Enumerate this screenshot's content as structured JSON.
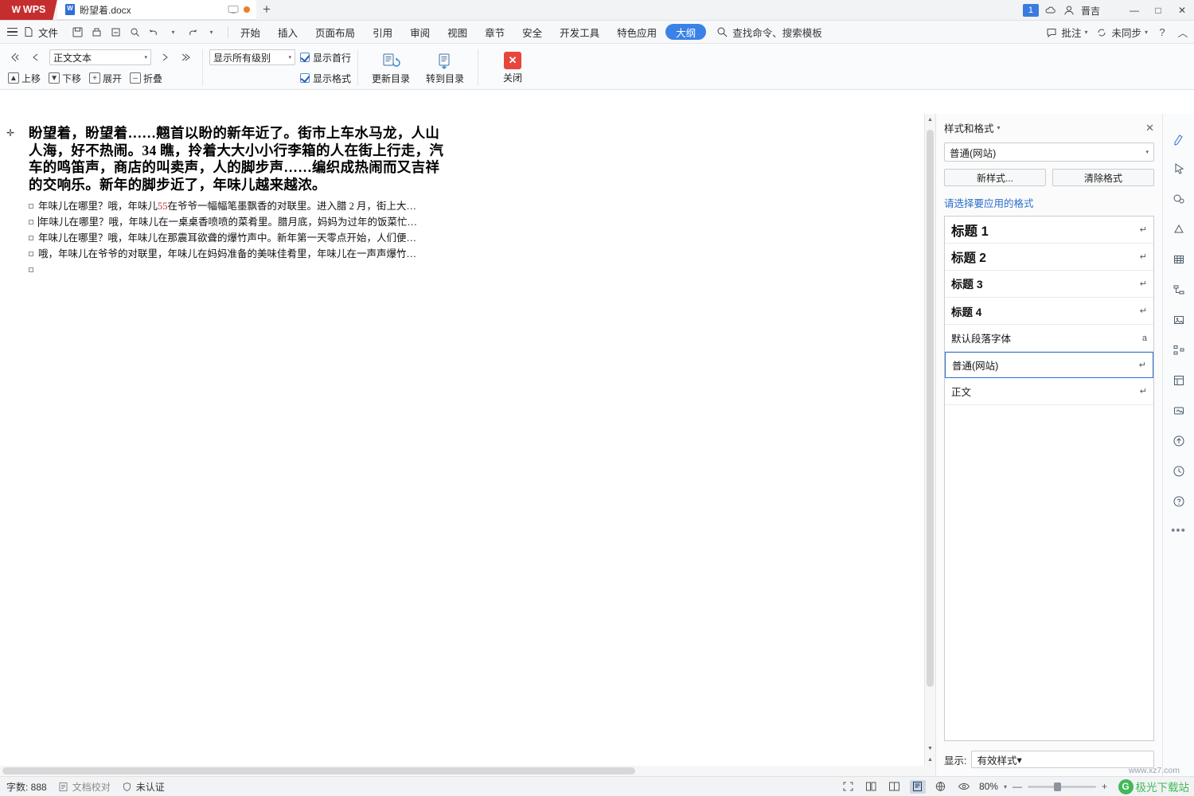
{
  "titlebar": {
    "app_name": "WPS",
    "tab_title": "盼望着.docx",
    "new_tab_label": "+",
    "badge_count": "1",
    "user_name": "晋吉",
    "minimize": "—",
    "maximize": "□",
    "close": "✕",
    "icons": [
      "wps-logo-icon",
      "doc-icon",
      "monitor-icon",
      "unsaved-dot-icon",
      "new-tab-icon",
      "cloud-icon",
      "user-icon"
    ]
  },
  "menubar": {
    "file_label": "文件",
    "items": [
      {
        "label": "开始",
        "active": false
      },
      {
        "label": "插入",
        "active": false
      },
      {
        "label": "页面布局",
        "active": false
      },
      {
        "label": "引用",
        "active": false
      },
      {
        "label": "审阅",
        "active": false
      },
      {
        "label": "视图",
        "active": false
      },
      {
        "label": "章节",
        "active": false
      },
      {
        "label": "安全",
        "active": false
      },
      {
        "label": "开发工具",
        "active": false
      },
      {
        "label": "特色应用",
        "active": false
      },
      {
        "label": "大纲",
        "active": true
      }
    ],
    "search_placeholder": "查找命令、搜索模板",
    "right_items": [
      {
        "label": "批注",
        "icon": "comment-icon"
      },
      {
        "label": "未同步",
        "icon": "sync-icon"
      }
    ],
    "help_label": "?",
    "collapse_label": "︿"
  },
  "ribbon": {
    "promote_label": "",
    "demote_label": "",
    "style_select": "正文文本",
    "level_select": "显示所有级别",
    "up_label": "上移",
    "down_label": "下移",
    "expand_label": "展开",
    "collapse_label": "折叠",
    "show_first_line": "显示首行",
    "show_format": "显示格式",
    "update_toc": "更新目录",
    "goto_toc": "转到目录",
    "close": "关闭",
    "checks": {
      "show_first_line_checked": true,
      "show_format_checked": true
    }
  },
  "document": {
    "heading": "盼望着，盼望着……翹首以盼的新年近了。街市上车水马龙，人山人海，好不热闹。34 瞧，拎着大大小小行李箱的人在街上行走，汽车的鸣笛声，商店的叫卖声，人的脚步声……编织成热闹而又吉祥的交响乐。新年的脚步近了，年味儿越来越浓。",
    "items": [
      {
        "pre": "年味儿在哪里？哦，年味儿",
        "red": "55",
        "post": "在爷爷一幅幅笔墨飘香的对联里。进入腊 2 月，街上大…"
      },
      {
        "pre": "",
        "red": "",
        "post": "年味儿在哪里？哦，年味儿在一桌桌香喷喷的菜肴里。腊月底，妈妈为过年的饭菜忙…"
      },
      {
        "pre": "",
        "red": "",
        "post": "年味儿在哪里？哦，年味儿在那震耳欲聋的爆竹声中。新年第一天零点开始，人们便…"
      },
      {
        "pre": "",
        "red": "",
        "post": "哦，年味儿在爷爷的对联里，年味儿在妈妈准备的美味佳肴里，年味儿在一声声爆竹…"
      },
      {
        "pre": "",
        "red": "",
        "post": ""
      }
    ]
  },
  "styles_pane": {
    "title": "样式和格式",
    "close": "✕",
    "current_style": "普通(网站)",
    "new_style_btn": "新样式...",
    "clear_format_btn": "清除格式",
    "hint": "请选择要应用的格式",
    "list": [
      {
        "name": "标题 1",
        "mark": "↵",
        "cls": "s-h1",
        "selected": false
      },
      {
        "name": "标题 2",
        "mark": "↵",
        "cls": "s-h2",
        "selected": false
      },
      {
        "name": "标题 3",
        "mark": "↵",
        "cls": "s-h3",
        "selected": false
      },
      {
        "name": "标题 4",
        "mark": "↵",
        "cls": "s-h4",
        "selected": false
      },
      {
        "name": "默认段落字体",
        "mark": "a",
        "cls": "s-reg",
        "selected": false
      },
      {
        "name": "普通(网站)",
        "mark": "↵",
        "cls": "s-reg",
        "selected": true
      },
      {
        "name": "正文",
        "mark": "↵",
        "cls": "s-reg",
        "selected": false
      }
    ],
    "footer_label": "显示:",
    "footer_value": "有效样式"
  },
  "rail": {
    "icons": [
      "style-brush-icon",
      "cursor-select-icon",
      "bubble-icon",
      "shape-icon",
      "table-icon",
      "chart-flow-icon",
      "image-icon",
      "tree-icon",
      "layout-icon",
      "picture-icon",
      "cloud-upload-icon",
      "history-icon",
      "help-circle-icon",
      "more-dots-icon"
    ]
  },
  "statusbar": {
    "word_count": "字数: 888",
    "proofread": "文档校对",
    "unverified": "未认证",
    "view_icons": [
      "fullscreen-icon",
      "two-page-icon",
      "reading-layout-icon",
      "page-layout-icon",
      "web-layout-icon",
      "eye-icon"
    ],
    "zoom_value": "80%",
    "zoom_minus": "—",
    "zoom_plus": "+",
    "watermark": "极光下载站",
    "watermark_sub": "www.xz7.com"
  },
  "colors": {
    "accent_blue": "#3b82e6",
    "brand_red": "#c52e2e",
    "close_red": "#e8453c",
    "link_blue": "#2a6fc9",
    "watermark_green": "#31b54a",
    "doc_red_text": "#c0392b"
  }
}
